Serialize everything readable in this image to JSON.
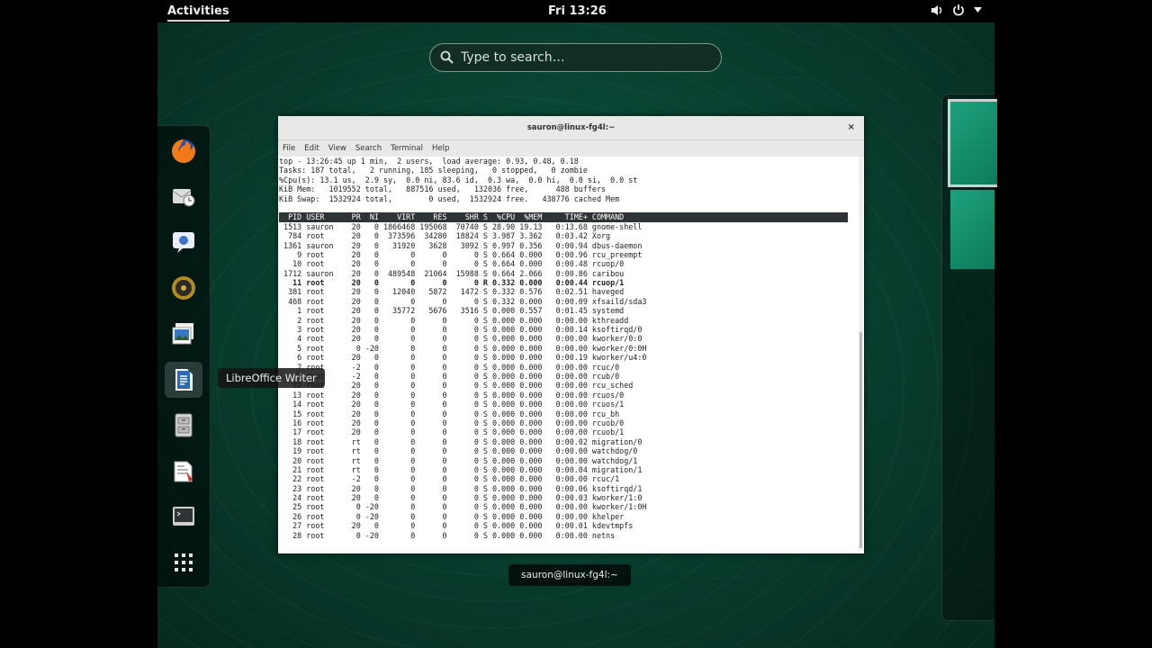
{
  "topbar": {
    "activities_label": "Activities",
    "clock": "Fri 13:26"
  },
  "search": {
    "placeholder": "Type to search…"
  },
  "dash": {
    "items": [
      {
        "name": "firefox-icon"
      },
      {
        "name": "evolution-icon"
      },
      {
        "name": "empathy-icon"
      },
      {
        "name": "rhythmbox-icon"
      },
      {
        "name": "shotwell-icon"
      },
      {
        "name": "libreoffice-writer-icon"
      },
      {
        "name": "file-manager-icon"
      },
      {
        "name": "document-viewer-icon"
      },
      {
        "name": "terminal-icon"
      },
      {
        "name": "show-applications-icon"
      }
    ],
    "tooltip": "LibreOffice Writer"
  },
  "window": {
    "title": "sauron@linux-fg4l:~",
    "close": "×",
    "menu": [
      "File",
      "Edit",
      "View",
      "Search",
      "Terminal",
      "Help"
    ],
    "summary": [
      "top - 13:26:45 up 1 min,  2 users,  load average: 0.93, 0.48, 0.18",
      "Tasks: 187 total,   2 running, 185 sleeping,   0 stopped,   0 zombie",
      "%Cpu(s): 13.1 us,  2.9 sy,  0.0 ni, 83.6 id,  0.3 wa,  0.0 hi,  0.0 si,  0.0 st",
      "KiB Mem:   1019552 total,   887516 used,   132036 free,      488 buffers",
      "KiB Swap:  1532924 total,        0 used,  1532924 free.   438776 cached Mem",
      ""
    ],
    "header": "  PID USER      PR  NI    VIRT    RES    SHR S  %CPU  %MEM     TIME+ COMMAND      ",
    "processes": [
      " 1513 sauron    20   0 1866468 195068  70740 S 28.90 19.13   0:13.68 gnome-shell",
      "  784 root      20   0  373596  34280  18824 S 3.987 3.362   0:03.42 Xorg",
      " 1361 sauron    20   0   31920   3628   3092 S 0.997 0.356   0:00.94 dbus-daemon",
      "    9 root      20   0       0      0      0 S 0.664 0.000   0:00.96 rcu_preempt",
      "   10 root      20   0       0      0      0 S 0.664 0.000   0:00.48 rcuop/0",
      " 1712 sauron    20   0  489548  21064  15988 S 0.664 2.066   0:00.86 caribou",
      "   11 root      20   0       0      0      0 R 0.332 0.000   0:00.44 rcuop/1",
      "  381 root      20   0   12040   5872   1472 S 0.332 0.576   0:02.51 haveged",
      "  468 root      20   0       0      0      0 S 0.332 0.000   0:00.09 xfsaild/sda3",
      "    1 root      20   0   35772   5676   3516 S 0.000 0.557   0:01.45 systemd",
      "    2 root      20   0       0      0      0 S 0.000 0.000   0:00.00 kthreadd",
      "    3 root      20   0       0      0      0 S 0.000 0.000   0:00.14 ksoftirqd/0",
      "    4 root      20   0       0      0      0 S 0.000 0.000   0:00.00 kworker/0:0",
      "    5 root       0 -20       0      0      0 S 0.000 0.000   0:00.00 kworker/0:0H",
      "    6 root      20   0       0      0      0 S 0.000 0.000   0:00.19 kworker/u4:0",
      "    7 root      -2   0       0      0      0 S 0.000 0.000   0:00.00 rcuc/0",
      "    8 root      -2   0       0      0      0 S 0.000 0.000   0:00.00 rcub/0",
      "   12 root      20   0       0      0      0 S 0.000 0.000   0:00.00 rcu_sched",
      "   13 root      20   0       0      0      0 S 0.000 0.000   0:00.00 rcuos/0",
      "   14 root      20   0       0      0      0 S 0.000 0.000   0:00.00 rcuos/1",
      "   15 root      20   0       0      0      0 S 0.000 0.000   0:00.00 rcu_bh",
      "   16 root      20   0       0      0      0 S 0.000 0.000   0:00.00 rcuob/0",
      "   17 root      20   0       0      0      0 S 0.000 0.000   0:00.00 rcuob/1",
      "   18 root      rt   0       0      0      0 S 0.000 0.000   0:00.02 migration/0",
      "   19 root      rt   0       0      0      0 S 0.000 0.000   0:00.00 watchdog/0",
      "   20 root      rt   0       0      0      0 S 0.000 0.000   0:00.00 watchdog/1",
      "   21 root      rt   0       0      0      0 S 0.000 0.000   0:00.04 migration/1",
      "   22 root      -2   0       0      0      0 S 0.000 0.000   0:00.00 rcuc/1",
      "   23 root      20   0       0      0      0 S 0.000 0.000   0:00.06 ksoftirqd/1",
      "   24 root      20   0       0      0      0 S 0.000 0.000   0:00.03 kworker/1:0",
      "   25 root       0 -20       0      0      0 S 0.000 0.000   0:00.00 kworker/1:0H",
      "   26 root       0 -20       0      0      0 S 0.000 0.000   0:00.00 khelper",
      "   27 root      20   0       0      0      0 S 0.000 0.000   0:00.01 kdevtmpfs",
      "   28 root       0 -20       0      0      0 S 0.000 0.000   0:00.00 netns"
    ],
    "bold_row": 6
  },
  "window_caption": "sauron@linux-fg4l:~",
  "colors": {
    "background": "#0b4a38",
    "workspace": "#1ea17c",
    "terminal_header": "#2e3436"
  }
}
